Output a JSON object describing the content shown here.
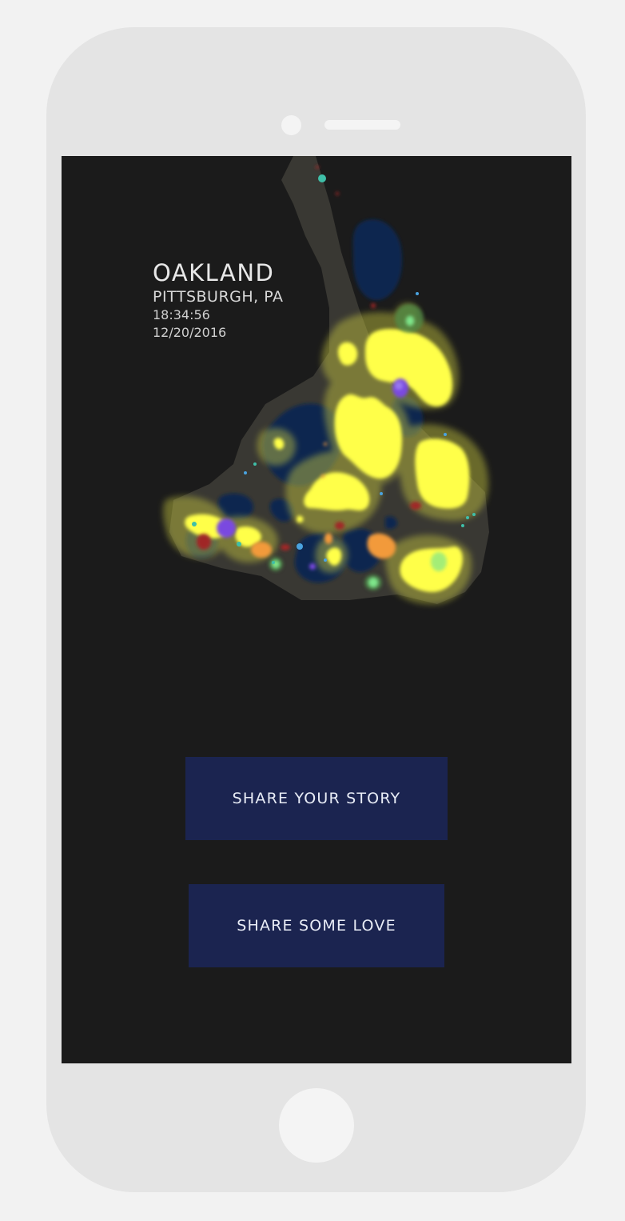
{
  "location": {
    "neighborhood": "OAKLAND",
    "city": "PITTSBURGH, PA",
    "time": "18:34:56",
    "date": "12/20/2016"
  },
  "actions": {
    "share_story_label": "SHARE YOUR STORY",
    "share_love_label": "SHARE SOME LOVE"
  },
  "colors": {
    "screen_background": "#1b1b1b",
    "button_background": "#1b2450",
    "heat_yellow": "#ffff4a",
    "heat_navy": "#0e2550",
    "heat_purple": "#7a4ae0",
    "heat_orange": "#f29a3a",
    "heat_red": "#a02828",
    "heat_green": "#7ee68a"
  }
}
